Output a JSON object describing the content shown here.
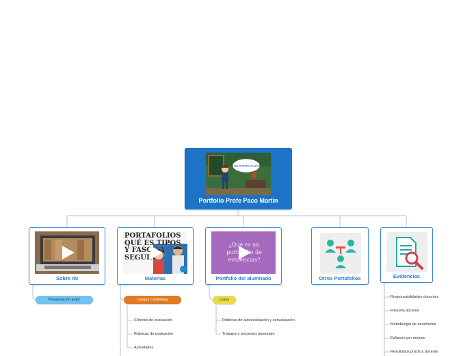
{
  "root": {
    "title": "Portfolio Profe Paco Martín",
    "image_text": "LOS PORTAFOLIOS"
  },
  "nodes": {
    "sobre_mi": {
      "title": "Sobre mi"
    },
    "materias": {
      "title": "Materias",
      "thumb_text": "PORTAFOLIOS QUÉ ES TIPOS Y FASOS A SEGUIR"
    },
    "portfolio_alumnado": {
      "title": "Portfolio del alumnado",
      "thumb_text": "¿Qué es un portafolio de evidencias?"
    },
    "otros_portafolios": {
      "title": "Otros Portafolios"
    },
    "evidencias": {
      "title": "Evidencias"
    }
  },
  "pills": {
    "presentacion": "Presentación autor",
    "lengua": "Lengua Castellana",
    "curso": "Curso"
  },
  "leaves": {
    "lengua": [
      "Criterios de evaluación",
      "Rúbricas de evaluación",
      "Actividades"
    ],
    "curso": [
      "Rubricas de autoevaluación y coevaluación",
      "Trabajos y proyectos alumnado"
    ],
    "evidencias": [
      "Responsabilidades docentes",
      "Filosofía docente",
      "Metodología de enseñanza",
      "Esfuerzo por mejorar",
      "Resultados práctica docente"
    ]
  },
  "colors": {
    "root": "#1d74c6",
    "node_border": "#3b8bd6",
    "node_text": "#2f7fc9",
    "pill_blue": "#6fc3ee",
    "pill_orange": "#e07a25",
    "pill_yellow": "#e9dc43",
    "connector": "#b8c2cc"
  },
  "icons": [
    "play-icon",
    "people-network-icon",
    "document-search-icon"
  ]
}
